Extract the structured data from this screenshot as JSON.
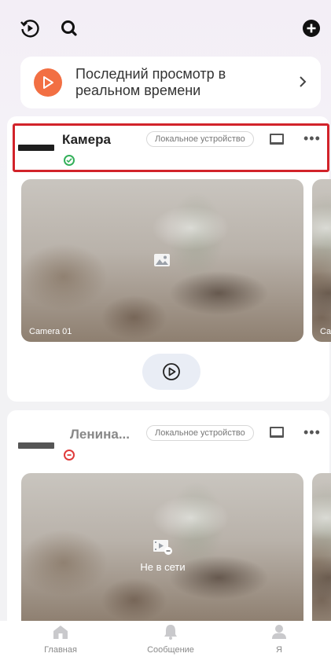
{
  "topbar": {
    "icons": [
      "replay-icon",
      "search-icon",
      "add-icon"
    ]
  },
  "live_view": {
    "label": "Последний просмотр в реальном времени",
    "icon": "play-icon"
  },
  "devices": [
    {
      "name": "Камера",
      "badge": "Локальное устройство",
      "status": "online",
      "status_color": "#34b05a",
      "channels": [
        {
          "label": "Camera 01"
        },
        {
          "label": "Ca"
        }
      ]
    },
    {
      "name": "Ленина...",
      "badge": "Локальное устройство",
      "status": "offline",
      "status_color": "#e03a3a",
      "offline_label": "Не в сети"
    }
  ],
  "colors": {
    "accent": "#f26f43",
    "highlight": "#d2232a"
  },
  "tabbar": {
    "tabs": [
      {
        "label": "Главная",
        "icon": "home-icon"
      },
      {
        "label": "Сообщение",
        "icon": "bell-icon"
      },
      {
        "label": "Я",
        "icon": "user-icon"
      }
    ]
  }
}
